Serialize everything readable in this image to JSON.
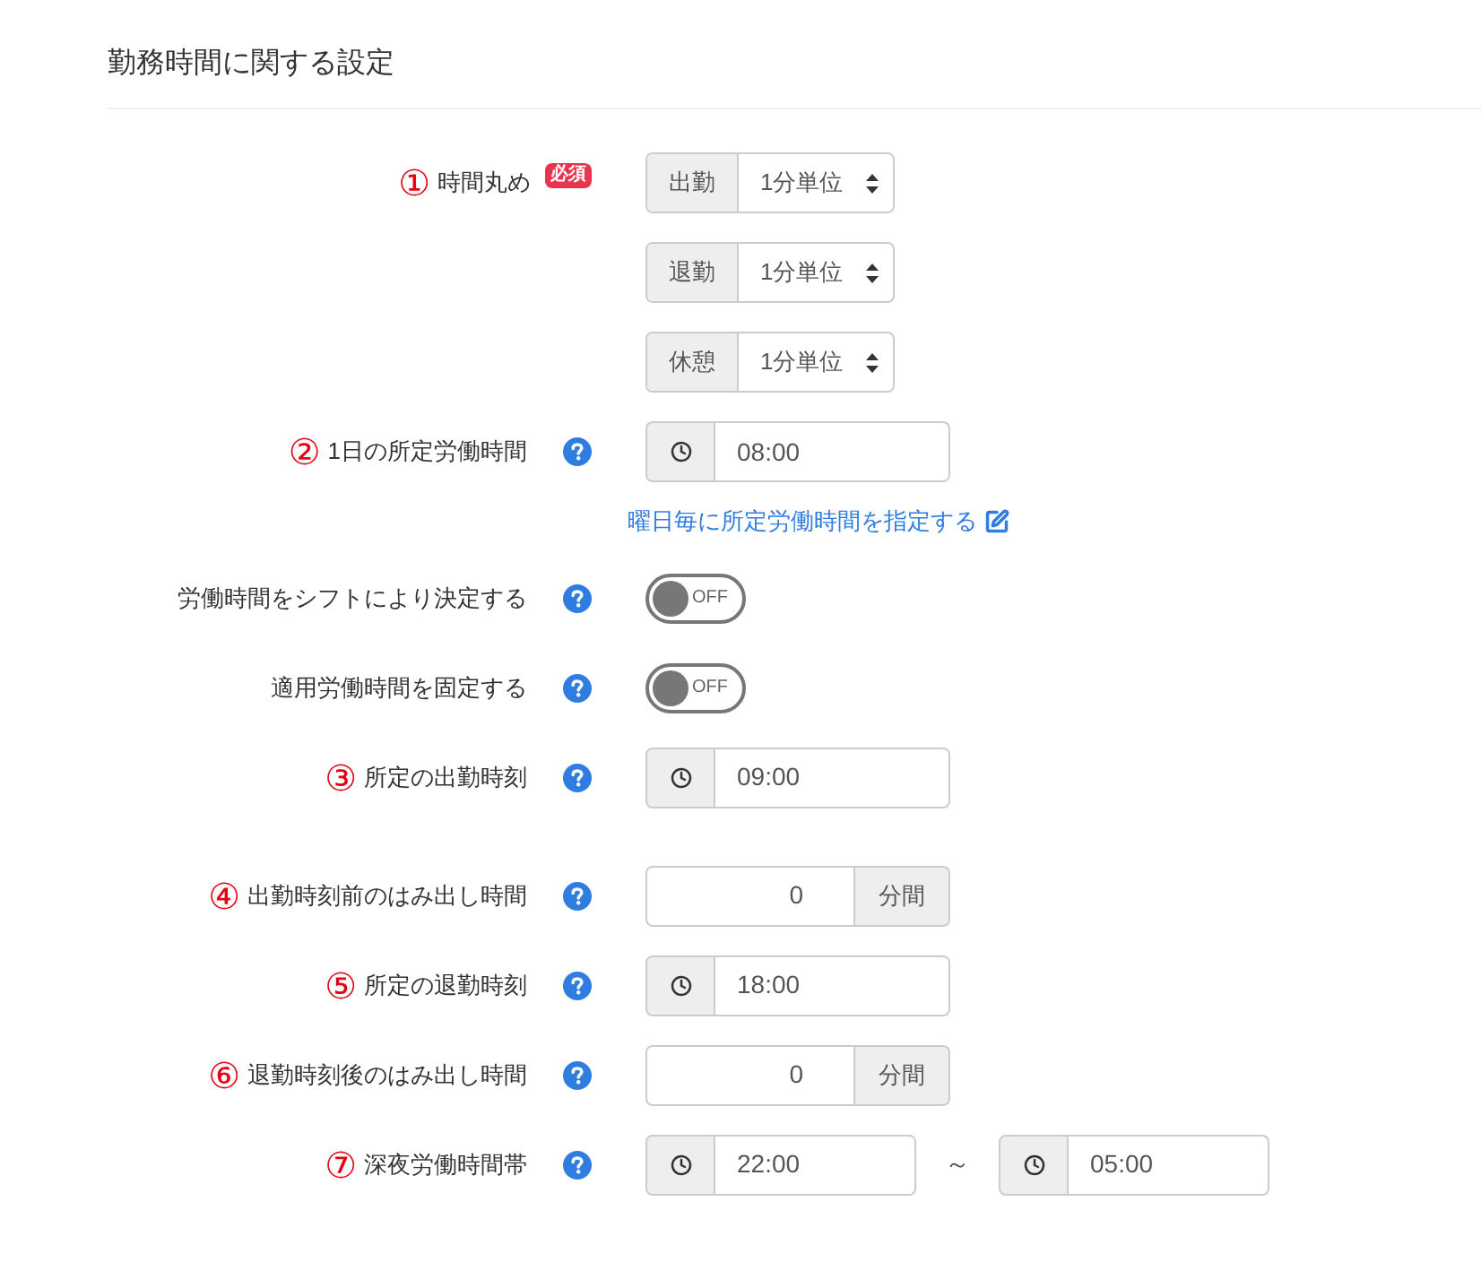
{
  "section": {
    "title": "勤務時間に関する設定"
  },
  "rows": [
    {
      "kind": "selects",
      "marker": "①",
      "label": "時間丸め",
      "badge": "必須",
      "help": false,
      "selects": [
        {
          "prefix": "出勤",
          "value": "1分単位"
        },
        {
          "prefix": "退勤",
          "value": "1分単位"
        },
        {
          "prefix": "休憩",
          "value": "1分単位"
        }
      ]
    },
    {
      "kind": "time",
      "marker": "②",
      "label": "1日の所定労働時間",
      "help": true,
      "value": "08:00"
    },
    {
      "kind": "link",
      "text": "曜日毎に所定労働時間を指定する"
    },
    {
      "kind": "toggle",
      "label": "労働時間をシフトにより決定する",
      "help": true,
      "on": false,
      "text": "OFF"
    },
    {
      "kind": "toggle",
      "label": "適用労働時間を固定する",
      "help": true,
      "on": false,
      "text": "OFF"
    },
    {
      "kind": "time",
      "marker": "③",
      "label": "所定の出勤時刻",
      "help": true,
      "value": "09:00"
    },
    {
      "kind": "minutes",
      "marker": "④",
      "label": "出勤時刻前のはみ出し時間",
      "help": true,
      "value": "0",
      "unit": "分間"
    },
    {
      "kind": "time",
      "marker": "⑤",
      "label": "所定の退勤時刻",
      "help": true,
      "value": "18:00"
    },
    {
      "kind": "minutes",
      "marker": "⑥",
      "label": "退勤時刻後のはみ出し時間",
      "help": true,
      "value": "0",
      "unit": "分間"
    },
    {
      "kind": "range",
      "marker": "⑦",
      "label": "深夜労働時間帯",
      "help": true,
      "from": "22:00",
      "separator": "～",
      "to": "05:00"
    }
  ]
}
